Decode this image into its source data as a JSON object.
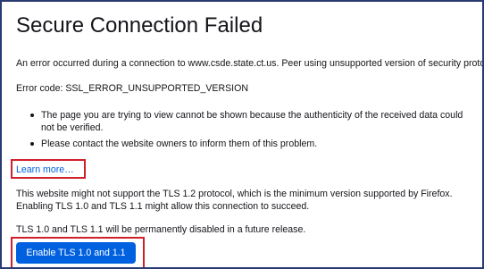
{
  "error_page": {
    "title": "Secure Connection Failed",
    "intro": "An error occurred during a connection to www.csde.state.ct.us. Peer using unsupported version of security protocol.",
    "error_code": "Error code: SSL_ERROR_UNSUPPORTED_VERSION",
    "bullets": [
      "The page you are trying to view cannot be shown because the authenticity of the received data could not be verified.",
      "Please contact the website owners to inform them of this problem."
    ],
    "learn_more": "Learn more…",
    "tls_info": "This website might not support the TLS 1.2 protocol, which is the minimum version supported by Firefox. Enabling TLS 1.0 and TLS 1.1 might allow this connection to succeed.",
    "tls_future": "TLS 1.0 and TLS 1.1 will be permanently disabled in a future release.",
    "enable_button": "Enable TLS 1.0 and 1.1"
  },
  "colors": {
    "accent": "#0061e0",
    "highlight_border": "#d0202a",
    "frame_border": "#2a3a73",
    "text": "#15141a"
  }
}
